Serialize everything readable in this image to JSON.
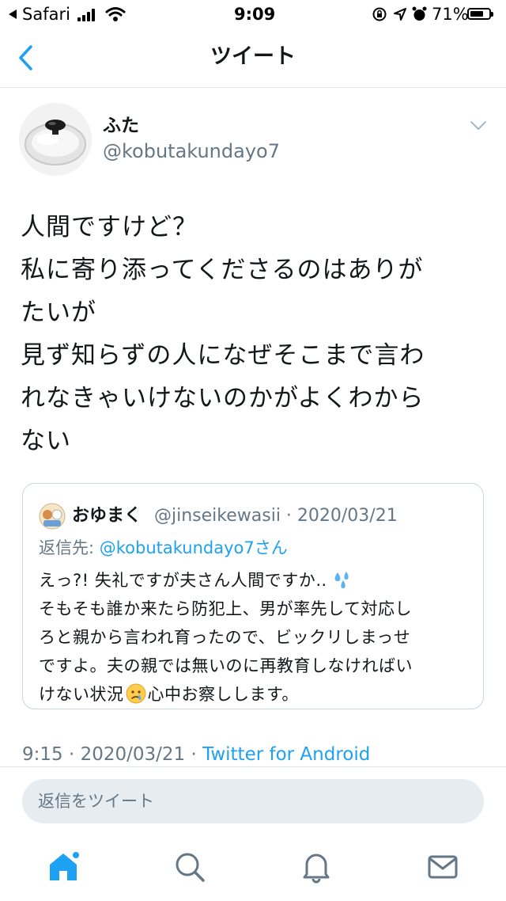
{
  "status_bar": {
    "back_app": "Safari",
    "time": "9:09",
    "battery_percent": "71%",
    "battery_level": 0.71
  },
  "nav": {
    "title": "ツイート",
    "back_icon": "chevron-left-icon"
  },
  "tweet": {
    "display_name": "ふた",
    "handle": "@kobutakundayo7",
    "text_lines": [
      "人間ですけど？",
      "私に寄り添ってくださるのはありが",
      "たいが",
      "見ず知らずの人になぜそこまで言わ",
      "れなきゃいけないのかがよくわから",
      "ない"
    ],
    "timestamp": "9:15 · 2020/03/21 · ",
    "source": "Twitter for Android"
  },
  "quote": {
    "display_name": "おゆまく",
    "handle_date": "@jinseikewasii · 2020/03/21",
    "reply_prefix": "返信先: ",
    "reply_handle": "@kobutakundayo7",
    "reply_suffix": "さん",
    "text_lines": [
      "えっ?! 失礼ですが夫さん人間ですか‥",
      "そもそも誰か来たら防犯上、男が率先して対応し",
      "ろと親から言われ育ったので、ビックリしまっせ",
      "ですよ。夫の親では無いのに再教育しなければい",
      "けない状況",
      "心中お察しします。"
    ],
    "emoji_after_line1": "sweat-droplets-icon",
    "emoji_in_line5": "crying-face-icon"
  },
  "reply": {
    "placeholder": "返信をツイート"
  },
  "tab_bar": {
    "items": [
      "home-icon",
      "search-icon",
      "notifications-icon",
      "messages-icon"
    ]
  },
  "colors": {
    "accent": "#1da1f2",
    "text_primary": "#14171a",
    "text_secondary": "#657786",
    "border": "#ccd6dd",
    "reply_bg": "#e6ecf0"
  }
}
